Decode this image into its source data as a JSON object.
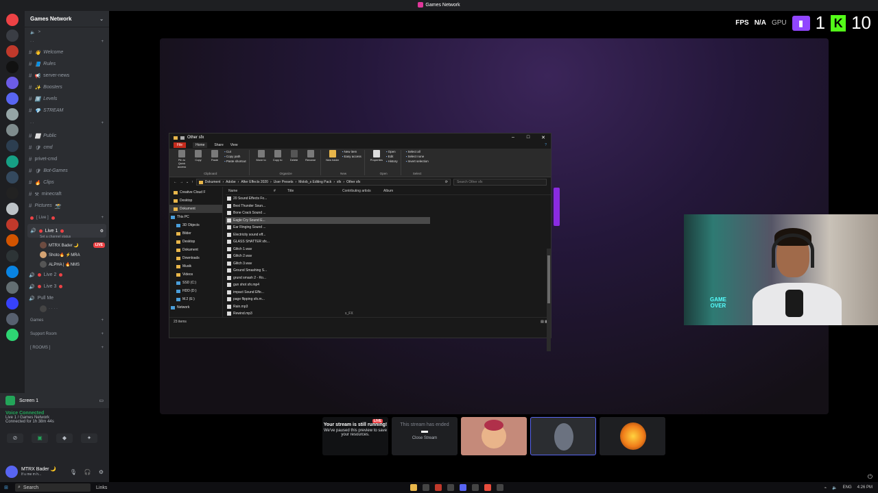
{
  "window": {
    "title": "Games Network"
  },
  "hud": {
    "fps_label": "FPS",
    "fps_value": "N/A",
    "gpu_label": "GPU",
    "twitch": "1",
    "kick": "10"
  },
  "server": {
    "name": "Games Network"
  },
  "channels": [
    {
      "name": "Welcome",
      "emoji": "👋"
    },
    {
      "name": "Rules",
      "emoji": "📘"
    },
    {
      "name": "server-news",
      "emoji": "📢"
    },
    {
      "name": "Boosters",
      "emoji": "✨"
    },
    {
      "name": "Levels",
      "emoji": "1️⃣"
    },
    {
      "name": "STREAM",
      "emoji": "💎"
    }
  ],
  "channels2": [
    {
      "name": "Public",
      "emoji": "⬜"
    },
    {
      "name": "cmd",
      "emoji": "🛡"
    },
    {
      "name": "privet-cmd",
      "emoji": ""
    },
    {
      "name": "Bot-Games",
      "emoji": "🛡"
    },
    {
      "name": "Clips",
      "emoji": "🔥"
    },
    {
      "name": "minecraft",
      "emoji": "⚒"
    },
    {
      "name": "Pictures",
      "emoji": "📸"
    }
  ],
  "live_category": "[ Live ]",
  "voice_channels": {
    "live1": "Live 1",
    "live1_status": "Set a channel status",
    "members": [
      {
        "name": "MTRX Bader 🌙",
        "badge": "LIVE"
      },
      {
        "name": "Shoto🔥 ⚡MRA",
        "badge": ""
      },
      {
        "name": "ALPHA | 🔥NMS",
        "badge": ""
      }
    ],
    "live2": "Live 2",
    "live3": "Live 3",
    "pullme": "Pull Me"
  },
  "categories": {
    "games": "Games",
    "support": "Support Room",
    "rooms": "[ ROOMS ]"
  },
  "voice_panel": {
    "screen_label": "Screen 1",
    "status": "Voice Connected",
    "location": "Live 1 / Games Network",
    "duration": "Connected for 1h 38m 44s"
  },
  "user": {
    "name": "MTRX Bader 🌙",
    "status": "If u me m h..."
  },
  "taskbar": {
    "search": "Search",
    "links": "Links",
    "lang": "ENG",
    "time": "4:26 PM"
  },
  "explorer": {
    "title": "Other sfx",
    "tabs": [
      "File",
      "Home",
      "Share",
      "View"
    ],
    "ribbon": {
      "clipboard": {
        "pin": "Pin to Quick access",
        "copy": "Copy",
        "paste": "Paste",
        "cut": "Cut",
        "copy_path": "Copy path",
        "paste_shortcut": "Paste shortcut",
        "label": "Clipboard"
      },
      "organize": {
        "move": "Move to",
        "copyto": "Copy to",
        "delete": "Delete",
        "rename": "Rename",
        "label": "Organize"
      },
      "new": {
        "folder": "New folder",
        "item": "New item",
        "easy": "Easy access",
        "label": "New"
      },
      "open": {
        "properties": "Properties",
        "open": "Open",
        "edit": "Edit",
        "history": "History",
        "label": "Open"
      },
      "select": {
        "all": "Select all",
        "none": "Select none",
        "invert": "Invert selection",
        "label": "Select"
      }
    },
    "path": [
      "Dokument",
      "Adobe",
      "After Effects 2020",
      "User Presets",
      "Molob_s Editing Pack",
      "sfx",
      "Other sfx"
    ],
    "search_placeholder": "Search Other sfx",
    "nav": [
      {
        "name": "Creative Cloud F",
        "type": "folder"
      },
      {
        "name": "Desktop",
        "type": "folder"
      },
      {
        "name": "Dokument",
        "type": "folder",
        "selected": true
      },
      {
        "name": "This PC",
        "type": "pc"
      },
      {
        "name": "3D Objects",
        "type": "pc"
      },
      {
        "name": "Bilder",
        "type": "folder"
      },
      {
        "name": "Desktop",
        "type": "folder"
      },
      {
        "name": "Dokument",
        "type": "folder"
      },
      {
        "name": "Downloads",
        "type": "folder"
      },
      {
        "name": "Musik",
        "type": "folder"
      },
      {
        "name": "Videos",
        "type": "folder"
      },
      {
        "name": "SSD (C:)",
        "type": "pc"
      },
      {
        "name": "HDD (D:)",
        "type": "pc"
      },
      {
        "name": "M.2 (E:)",
        "type": "pc"
      },
      {
        "name": "Network",
        "type": "pc"
      }
    ],
    "columns": [
      "Name",
      "#",
      "Title",
      "Contributing artists",
      "Album"
    ],
    "files": [
      "20 Sound Effects Fo...",
      "Best Thunder Soun...",
      "Bone Crack Sound ...",
      "Eagle Cry Sound E...",
      "Ear Ringing Sound ...",
      "Electricity sound eff...",
      "GLASS SHATTER sfx...",
      "Glitch 1.wav",
      "Glitch 2.wav",
      "Glitch 3.wav",
      "Ground Smashing S...",
      "grund smash 2 - Ro...",
      "gun shot sfx.mp4",
      "impact Sound Effe...",
      "page flipping sfx.m...",
      "Rain.mp3",
      "Rewind.mp3"
    ],
    "artist_cell": "x_FX",
    "status": "23 items"
  },
  "tiles": [
    {
      "line1": "Your stream is still running!",
      "line2": "We've paused this preview to save your resources.",
      "badge": "LIVE"
    },
    {
      "line1": "This stream has ended",
      "line2": "Close Stream"
    }
  ],
  "webcam_sign": "GAME OVER"
}
